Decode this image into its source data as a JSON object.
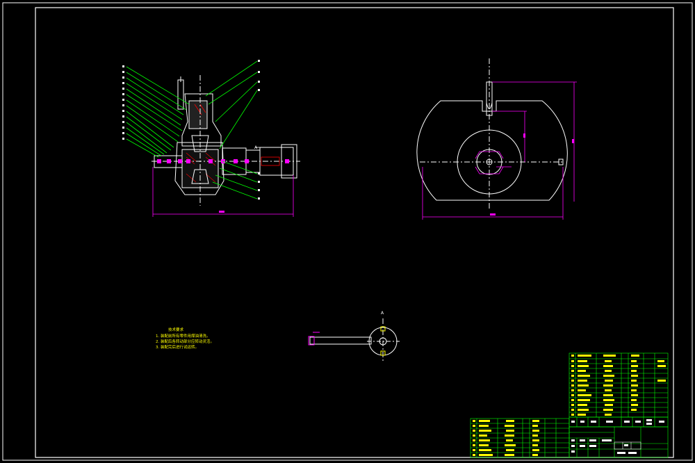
{
  "drawing": {
    "background": "#000000",
    "colors": {
      "frame": "#ffffff",
      "part": "#ffffff",
      "leader": "#00ff00",
      "dimension": "#ff00ff",
      "note": "#ffff00",
      "table_line": "#00ff00",
      "table_text": "#ffff00",
      "centerline": "#ffffff"
    },
    "section_mark": "A",
    "section_mark_top": "A",
    "notes": {
      "title": "技术要求",
      "lines": [
        "1. 装配前所有零件用煤油清洗。",
        "2. 装配后各转动部分应转动灵活。",
        "3. 装配完后进行试运转。"
      ]
    }
  }
}
